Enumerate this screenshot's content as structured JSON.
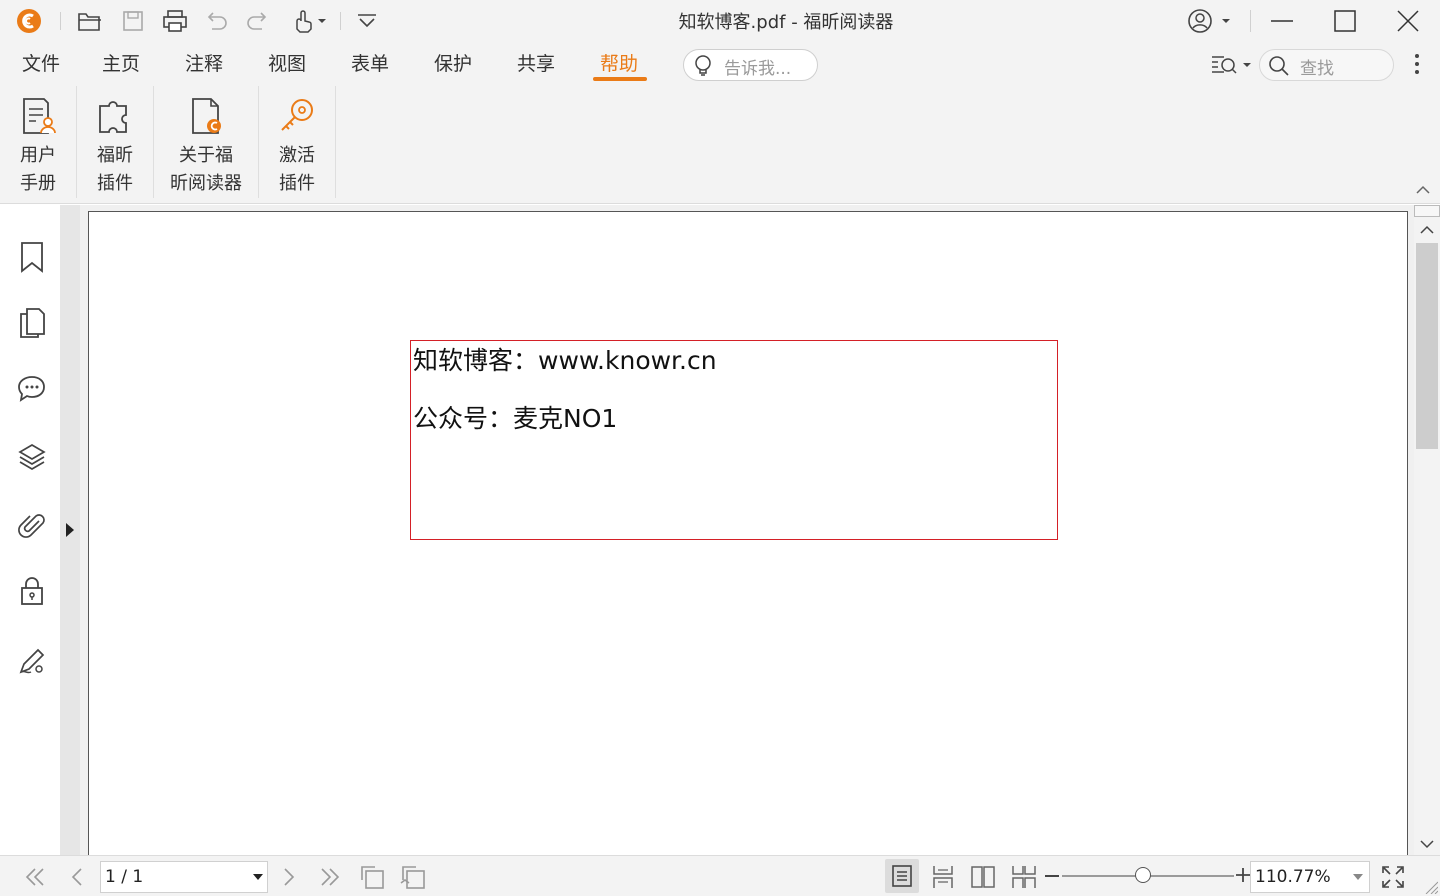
{
  "window": {
    "title": "知软博客.pdf - 福昕阅读器"
  },
  "menu": {
    "tabs": [
      "文件",
      "主页",
      "注释",
      "视图",
      "表单",
      "保护",
      "共享",
      "帮助"
    ],
    "active": "帮助",
    "tell_me_placeholder": "告诉我...",
    "search_placeholder": "查找"
  },
  "ribbon": {
    "buttons": [
      {
        "line1": "用户",
        "line2": "手册",
        "icon": "user-manual-icon"
      },
      {
        "line1": "福昕",
        "line2": "插件",
        "icon": "plugin-icon"
      },
      {
        "line1": "关于福",
        "line2": "昕阅读器",
        "icon": "about-icon"
      },
      {
        "line1": "激活",
        "line2": "插件",
        "icon": "activate-key-icon"
      }
    ]
  },
  "sidebar": {
    "icons": [
      "bookmark-icon",
      "pages-icon",
      "comments-icon",
      "layers-icon",
      "attachment-icon",
      "security-icon",
      "signature-icon"
    ]
  },
  "document": {
    "line1": "知软博客：www.knowr.cn",
    "line2": "公众号：麦克NO1",
    "box_color": "#d42027"
  },
  "status": {
    "page": "1 / 1",
    "zoom": "110.77%",
    "zoom_level_fraction": 0.47
  },
  "colors": {
    "accent": "#ea7b17",
    "chrome_bg": "#f3f3f3"
  }
}
